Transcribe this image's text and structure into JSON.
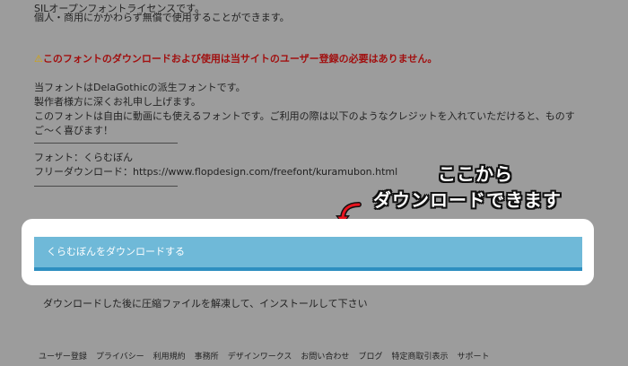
{
  "intro": {
    "line1": "SILオープンフォントライセンスです。",
    "line2": "個人・商用にかかわらず無償で使用することができます。"
  },
  "warning": {
    "icon": "warning-icon",
    "text": "このフォントのダウンロードおよび使用は当サイトのユーザー登録の必要はありません。"
  },
  "body_text": {
    "l1": "当フォントはDelaGothicの派生フォントです。",
    "l2": "製作者様方に深くお礼申し上げます。",
    "l3": "このフォントは自由に動画にも使えるフォントです。ご利用の際は以下のようなクレジットを入れていただけると、ものす",
    "l4": "ご～く喜びます！"
  },
  "credit": {
    "font_line": "フォント：くらむぼん",
    "download_line": "フリーダウンロード：https://www.flopdesign.com/freefont/kuramubon.html"
  },
  "annotation": {
    "line1": "ここから",
    "line2": "ダウンロードできます",
    "arrow_color": "#e8141e"
  },
  "download_button": {
    "label": "くらむぼんをダウンロードする"
  },
  "after_note": "ダウンロードした後に圧縮ファイルを解凍して、インストールして下さい",
  "footer_links": [
    "ユーザー登録",
    "プライバシー",
    "利用規約",
    "事務所",
    "デザインワークス",
    "お問い合わせ",
    "ブログ",
    "特定商取引表示",
    "サポート"
  ]
}
